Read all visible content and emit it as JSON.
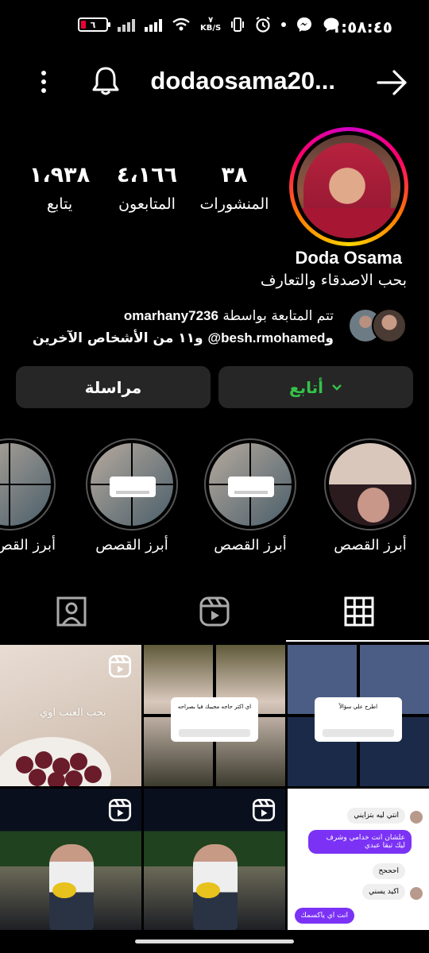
{
  "status_bar": {
    "time": "١:٥٨:٤٥",
    "battery": "٦",
    "net_speed_value": "٧",
    "net_speed_unit": "KB/S"
  },
  "header": {
    "username": "dodaosama20...",
    "icons": [
      "menu-dots-icon",
      "bell-icon",
      "back-arrow-icon"
    ]
  },
  "profile": {
    "stats": [
      {
        "value": "٣٨",
        "label": "المنشورات"
      },
      {
        "value": "٤،١٦٦",
        "label": "المتابعون"
      },
      {
        "value": "١،٩٣٨",
        "label": "يتابع"
      }
    ],
    "name": "Doda Osama",
    "bio": "بحب الاصدقاء والتعارف",
    "followed_by": {
      "prefix": "تتم المتابعة بواسطة",
      "user1": "omarhany7236",
      "joiner": "و",
      "user2": "besh.rmohamed@",
      "suffix": "و١١ من الأشخاص الآخرين"
    }
  },
  "buttons": {
    "follow": "أتابع",
    "message": "مراسلة"
  },
  "highlights": [
    {
      "label": "أبرز القصص"
    },
    {
      "label": "أبرز القصص"
    },
    {
      "label": "أبرز القصص"
    },
    {
      "label": "أبرز القص"
    }
  ],
  "tabs": [
    "grid-icon",
    "reels-icon",
    "tagged-icon"
  ],
  "posts": {
    "post1_caption": "بحب العنب اوي",
    "post2_card": "اي اكتر حاجه مجيبك فيا بصراحه",
    "post3_card": "اطرح علي سؤالاً",
    "chat": [
      {
        "text": "انتي ليه بتزايني",
        "dir": "in"
      },
      {
        "text": "علشان انت خدامي وشرف ليك تبقا عبدي",
        "dir": "out"
      },
      {
        "text": "احححح",
        "dir": "in"
      },
      {
        "text": "اكيد يسني",
        "dir": "in"
      },
      {
        "text": "انت اي ياكسمك",
        "dir": "out"
      }
    ]
  }
}
